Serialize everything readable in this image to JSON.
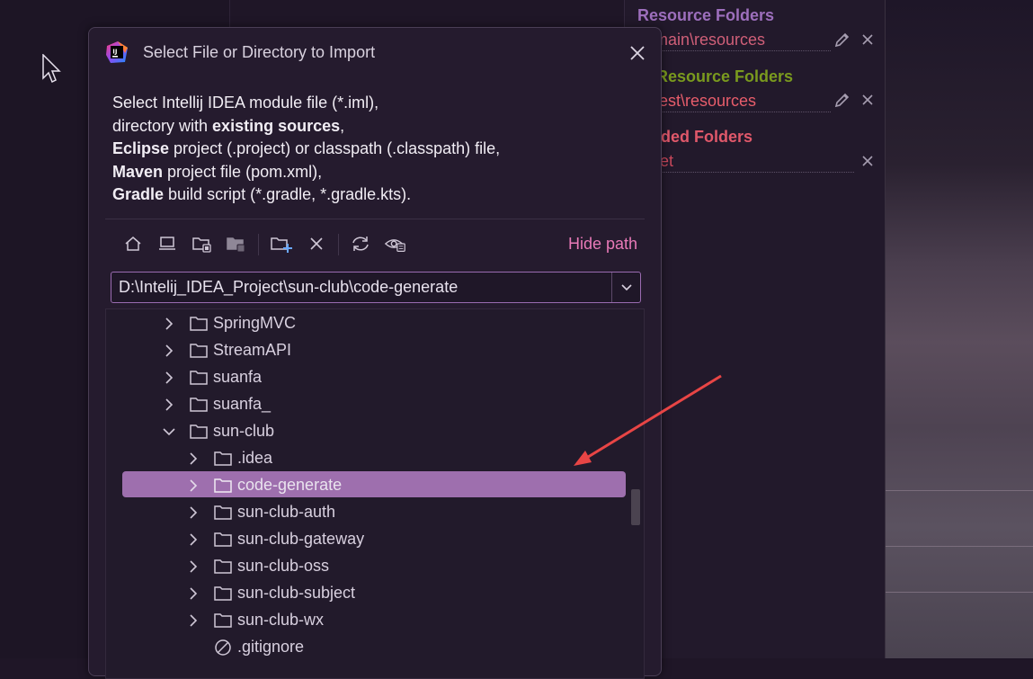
{
  "right_panel": {
    "sections": [
      {
        "title": "Resource Folders",
        "title_color": "#9d6fbd",
        "path": "rc\\main\\resources",
        "path_color": "#d05f78",
        "actions": [
          "pencil-icon",
          "close-icon"
        ]
      },
      {
        "title": "st Resource Folders",
        "title_color": "#7a9a1e",
        "path": "rc\\test\\resources",
        "path_color": "#e85d6b",
        "actions": [
          "pencil-icon",
          "close-icon"
        ]
      },
      {
        "title": "cluded Folders",
        "title_color": "#e0586a",
        "path": "arget",
        "path_color": "#c9485b",
        "actions": [
          "close-icon"
        ]
      }
    ]
  },
  "dialog": {
    "title": "Select File or Directory to Import",
    "description": {
      "line1": "Select Intellij IDEA module file (*.iml),",
      "line2_pre": "directory with ",
      "line2_bold": "existing sources",
      "line2_post": ",",
      "line3_bold": "Eclipse",
      "line3_post": " project (.project) or classpath (.classpath) file,",
      "line4_bold": "Maven",
      "line4_post": " project file (pom.xml),",
      "line5_bold": "Gradle",
      "line5_post": " build script (*.gradle, *.gradle.kts)."
    },
    "toolbar": {
      "buttons": [
        "home-icon",
        "desktop-icon",
        "project-folder-icon",
        "module-folder-icon",
        "new-folder-icon",
        "delete-icon",
        "refresh-icon",
        "show-hidden-icon"
      ],
      "hide_path_label": "Hide path"
    },
    "path_value": "D:\\Intelij_IDEA_Project\\sun-club\\code-generate",
    "tree": [
      {
        "label": "SpringMVC",
        "expanded": false,
        "type": "folder",
        "level": 0
      },
      {
        "label": "StreamAPI",
        "expanded": false,
        "type": "folder",
        "level": 0
      },
      {
        "label": "suanfa",
        "expanded": false,
        "type": "folder",
        "level": 0
      },
      {
        "label": "suanfa_",
        "expanded": false,
        "type": "folder",
        "level": 0
      },
      {
        "label": "sun-club",
        "expanded": true,
        "type": "folder",
        "level": 0
      },
      {
        "label": ".idea",
        "expanded": false,
        "type": "folder",
        "level": 1
      },
      {
        "label": "code-generate",
        "expanded": false,
        "type": "folder",
        "level": 1,
        "selected": true
      },
      {
        "label": "sun-club-auth",
        "expanded": false,
        "type": "folder",
        "level": 1
      },
      {
        "label": "sun-club-gateway",
        "expanded": false,
        "type": "folder",
        "level": 1
      },
      {
        "label": "sun-club-oss",
        "expanded": false,
        "type": "folder",
        "level": 1
      },
      {
        "label": "sun-club-subject",
        "expanded": false,
        "type": "folder",
        "level": 1
      },
      {
        "label": "sun-club-wx",
        "expanded": false,
        "type": "folder",
        "level": 1
      },
      {
        "label": ".gitignore",
        "expanded": false,
        "type": "ignored-file",
        "level": 1
      }
    ]
  },
  "colors": {
    "accent": "#9e6fae",
    "link": "#e97ab8",
    "annotation_arrow": "#e84545"
  }
}
